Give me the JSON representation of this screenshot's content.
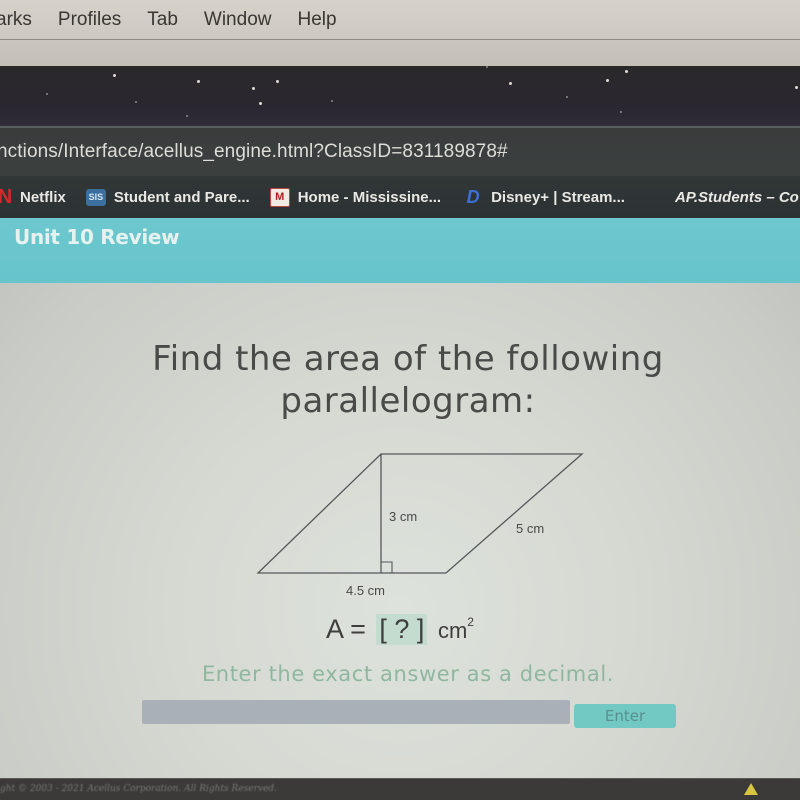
{
  "menubar": {
    "items": [
      "arks",
      "Profiles",
      "Tab",
      "Window",
      "Help"
    ]
  },
  "addressbar": {
    "url": "nctions/Interface/acellus_engine.html?ClassID=831189878#"
  },
  "bookmarks": [
    {
      "icon": "netflix-icon",
      "glyph": "N",
      "label": "Netflix"
    },
    {
      "icon": "sis-icon",
      "glyph": "SIS",
      "label": "Student and Pare..."
    },
    {
      "icon": "mississinewa-icon",
      "glyph": "M",
      "label": "Home - Mississine..."
    },
    {
      "icon": "disney-icon",
      "glyph": "D",
      "label": "Disney+ | Stream..."
    },
    {
      "icon": "none",
      "glyph": "",
      "label": "AP.Students – Co"
    }
  ],
  "page": {
    "unit_title": "Unit 10 Review",
    "question_line1": "Find the area of the following",
    "question_line2": "parallelogram:",
    "figure": {
      "height_label": "3 cm",
      "side_label": "5 cm",
      "base_label": "4.5 cm",
      "height_cm": 3,
      "side_cm": 5,
      "base_cm": 4.5
    },
    "formula": {
      "lhs": "A",
      "equals": "=",
      "blank": "[ ? ]",
      "unit": "cm",
      "exponent": "2"
    },
    "instruction": "Enter the exact answer as a decimal.",
    "answer_value": "",
    "answer_placeholder": "",
    "enter_label": "Enter"
  },
  "footer": {
    "copyright": "ght © 2003 - 2021 Acellus Corporation.  All Rights Reserved."
  },
  "colors": {
    "header_teal": "#6cc8ce",
    "instruction_green": "#8fb79f",
    "enter_button": "#72c8c3",
    "answer_blank_bg": "#c4dcd0"
  }
}
